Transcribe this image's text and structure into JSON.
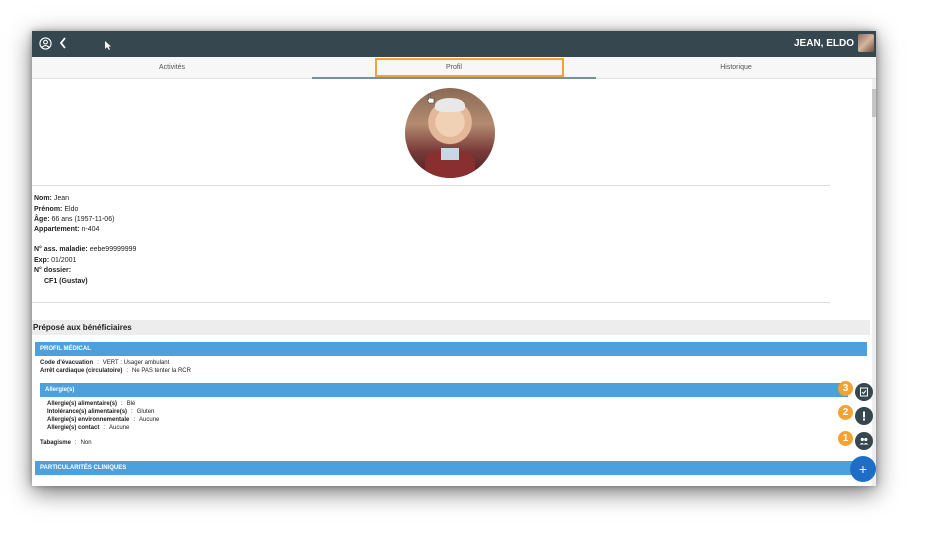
{
  "header": {
    "username": "JEAN, ELDO"
  },
  "tabs": [
    {
      "label": "Activités"
    },
    {
      "label": "Profil"
    },
    {
      "label": "Historique"
    }
  ],
  "profile": {
    "nom_label": "Nom:",
    "nom": "Jean",
    "prenom_label": "Prénom:",
    "prenom": "Eldo",
    "age_label": "Âge:",
    "age": "66 ans (1957-11-06)",
    "appartement_label": "Appartement:",
    "appartement": "n-404",
    "assurance_label": "N° ass. maladie:",
    "assurance": "eebe99999999",
    "exp_label": "Exp:",
    "exp": "01/2001",
    "dossier_label": "N° dossier:",
    "dossier_value": "CF1 (Gustav)"
  },
  "section_title": "Préposé aux bénéficiaires",
  "profil_medical": {
    "header": "PROFIL MÉDICAL",
    "code_evacuation_label": "Code d'évacuation",
    "code_evacuation": "VERT : Usager ambulant",
    "arret_cardiaque_label": "Arrêt cardiaque (circulatoire)",
    "arret_cardiaque": "Ne PAS tenter la RCR"
  },
  "allergies": {
    "header": "Allergie(s)",
    "alimentaire_label": "Allergie(s) alimentaire(s)",
    "alimentaire": "Blé",
    "intolerance_label": "Intolérance(s) alimentaire(s)",
    "intolerance": "Gluten",
    "environnementale_label": "Allergie(s) environnementale",
    "environnementale": "Aucune",
    "contact_label": "Allergie(s) contact",
    "contact": "Aucune"
  },
  "tabagisme": {
    "label": "Tabagisme",
    "value": "Non"
  },
  "particularites": {
    "header": "PARTICULARITÉS CLINIQUES"
  },
  "kv_separator": ":",
  "badges": [
    "3",
    "2",
    "1"
  ],
  "fab_add_label": "+",
  "colors": {
    "topbar": "#37474f",
    "accent_blue": "#4ea0dc",
    "highlight_orange": "#f5a235",
    "fab_blue": "#1e6ec8"
  },
  "icons": {
    "fab1": "clipboard-check-icon",
    "fab2": "exclamation-icon",
    "fab3": "group-icon"
  }
}
